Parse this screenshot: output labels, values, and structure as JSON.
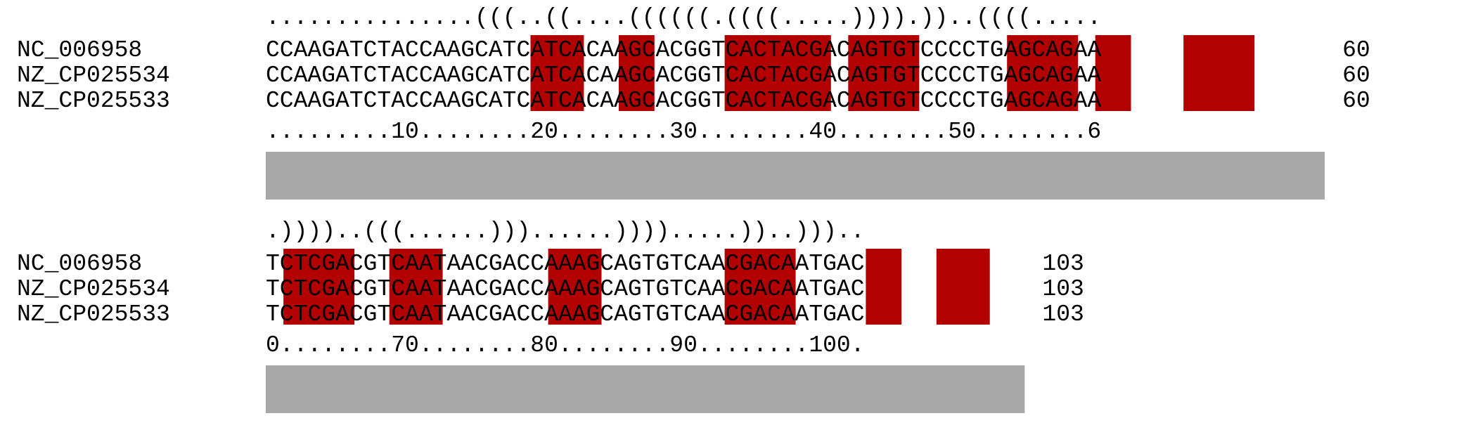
{
  "blocks": [
    {
      "structure": "...............(((..((....((((((.((((.....)))).))..((((.....",
      "rows": [
        {
          "name": "NC_006958",
          "sequence": "CCAAGATCTACCAAGCATCATCACAAGCACGGTCACTACGACAGTGTCCCCTGAGCAGAA",
          "end": "60"
        },
        {
          "name": "NZ_CP025534",
          "sequence": "CCAAGATCTACCAAGCATCATCACAAGCACGGTCACTACGACAGTGTCCCCTGAGCAGAA",
          "end": "60"
        },
        {
          "name": "NZ_CP025533",
          "sequence": "CCAAGATCTACCAAGCATCATCACAAGCACGGTCACTACGACAGTGTCCCCTGAGCAGAA",
          "end": "60"
        }
      ],
      "ruler": ".........10........20........30........40........50........6",
      "highlight_columns": [
        16,
        17,
        18,
        21,
        22,
        27,
        28,
        29,
        30,
        31,
        32,
        34,
        35,
        36,
        37,
        43,
        44,
        45,
        46,
        48,
        49,
        53,
        54,
        55,
        56
      ]
    },
    {
      "structure": ".))))..(((......)))......)))).....))..)))..",
      "rows": [
        {
          "name": "NC_006958",
          "sequence": "TCTCGACGTCAATAACGACCAAAGCAGTGTCAACGACAATGAC",
          "end": "103"
        },
        {
          "name": "NZ_CP025534",
          "sequence": "TCTCGACGTCAATAACGACCAAAGCAGTGTCAACGACAATGAC",
          "end": "103"
        },
        {
          "name": "NZ_CP025533",
          "sequence": "TCTCGACGTCAATAACGACCAAAGCAGTGTCAACGACAATGAC",
          "end": "103"
        }
      ],
      "ruler": "0........70........80........90........100.",
      "highlight_columns": [
        2,
        3,
        4,
        5,
        8,
        9,
        10,
        17,
        18,
        19,
        27,
        28,
        29,
        30,
        35,
        36,
        39,
        40,
        41
      ]
    }
  ],
  "colors": {
    "highlight": "#b30000",
    "conservation_bar": "#a8a8a8",
    "text": "#000000"
  }
}
